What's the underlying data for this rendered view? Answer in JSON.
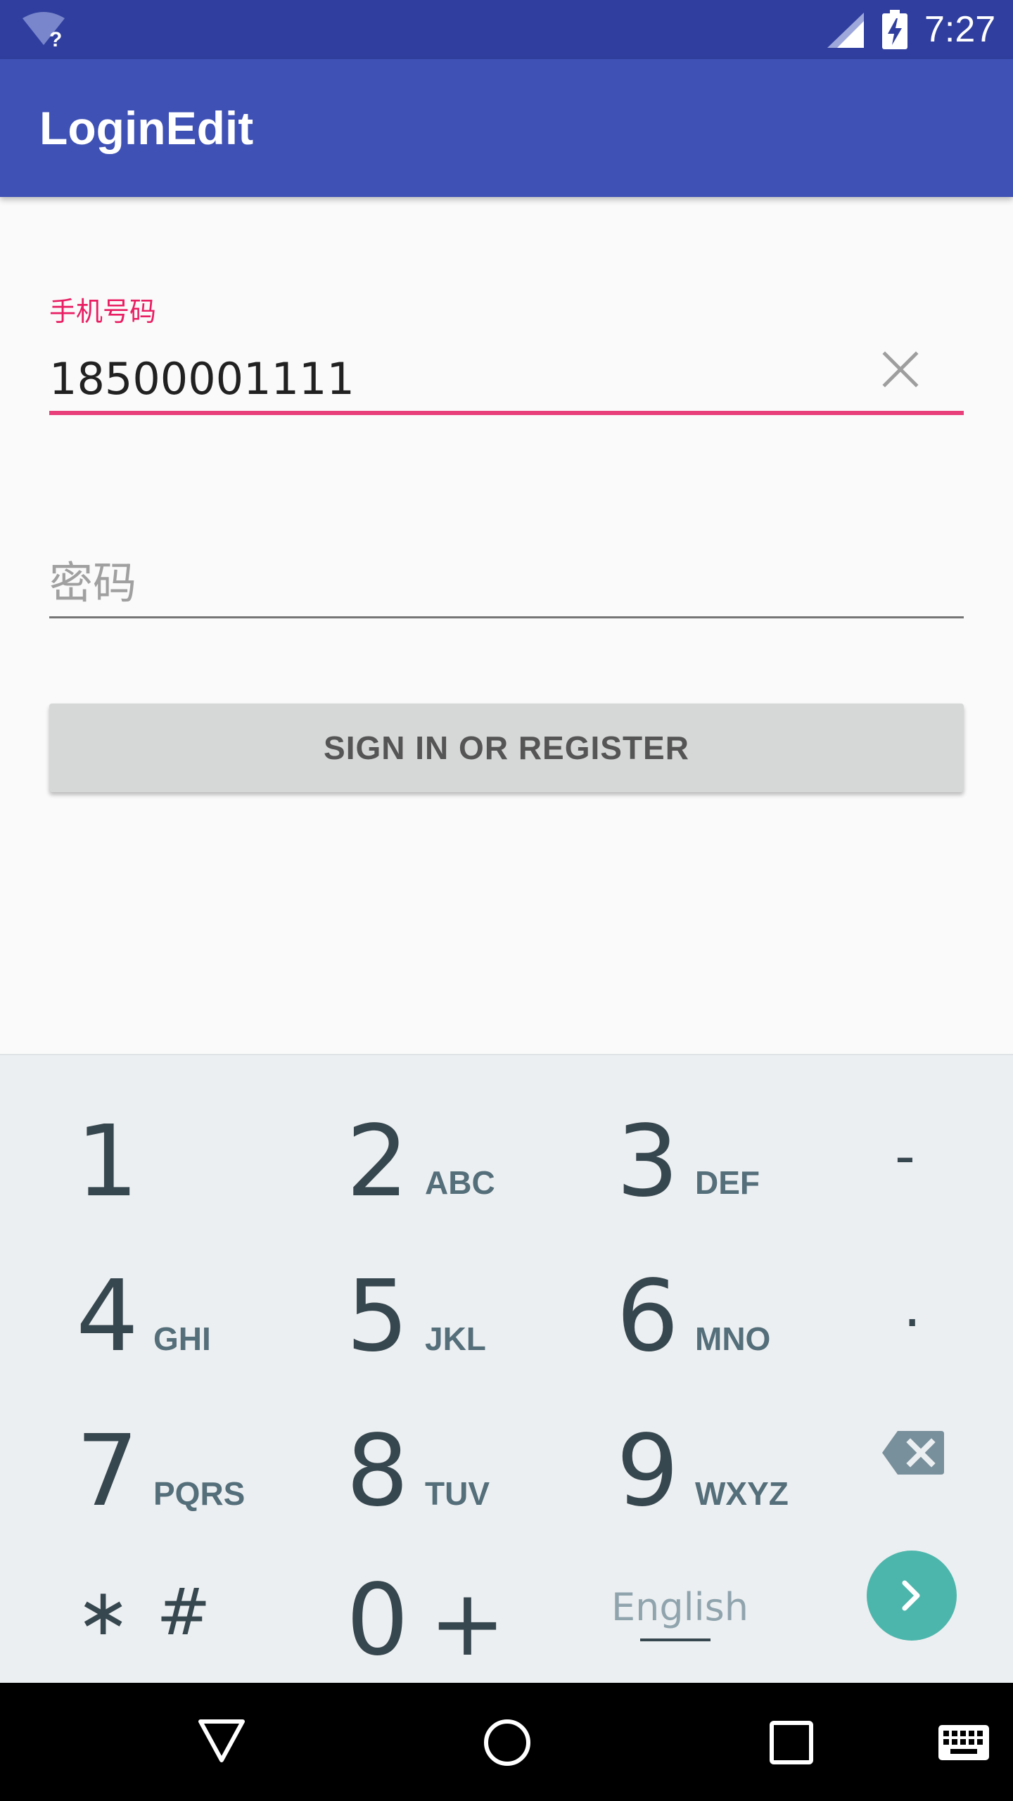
{
  "status_bar": {
    "time": "7:27",
    "wifi_badge": "?"
  },
  "app_bar": {
    "title": "LoginEdit"
  },
  "form": {
    "phone_label": "手机号码",
    "phone_value": "18500001111",
    "password_placeholder": "密码",
    "sign_in_label": "SIGN IN OR REGISTER"
  },
  "keyboard": {
    "keys": [
      {
        "num": "1",
        "letters": ""
      },
      {
        "num": "2",
        "letters": "ABC"
      },
      {
        "num": "3",
        "letters": "DEF"
      },
      {
        "num": "4",
        "letters": "GHI"
      },
      {
        "num": "5",
        "letters": "JKL"
      },
      {
        "num": "6",
        "letters": "MNO"
      },
      {
        "num": "7",
        "letters": "PQRS"
      },
      {
        "num": "8",
        "letters": "TUV"
      },
      {
        "num": "9",
        "letters": "WXYZ"
      },
      {
        "num": "0",
        "letters": "+"
      }
    ],
    "dash": "-",
    "dot": ".",
    "star_hash": "∗ #",
    "language": "English"
  },
  "colors": {
    "status_bar": "#303f9f",
    "app_bar": "#3f51b5",
    "accent": "#e91e63",
    "enter_key": "#4db6ac"
  },
  "icons": [
    "wifi-icon",
    "signal-icon",
    "battery-charging-icon",
    "clear-icon",
    "backspace-icon",
    "chevron-right-icon",
    "back-icon",
    "home-icon",
    "recents-icon",
    "keyboard-icon"
  ]
}
